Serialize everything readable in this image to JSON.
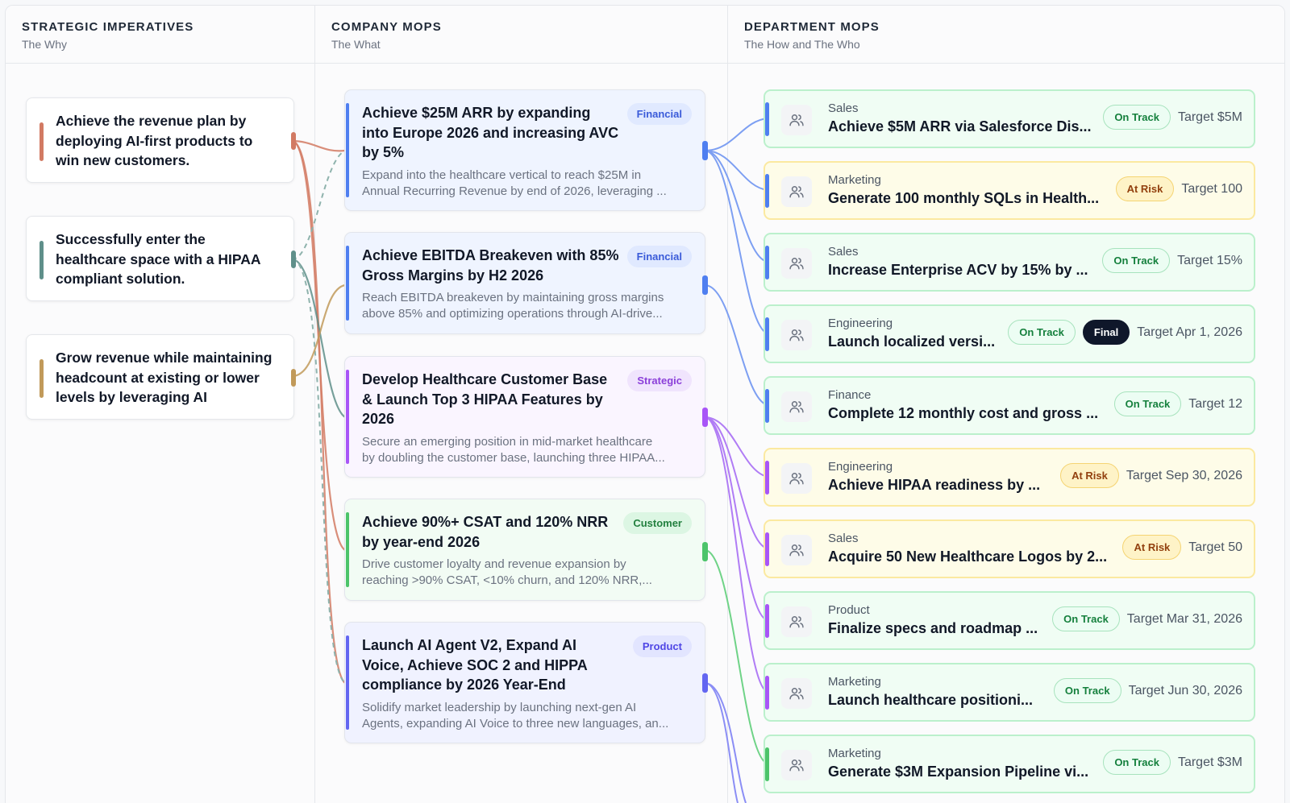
{
  "columns": [
    {
      "title": "STRATEGIC IMPERATIVES",
      "subtitle": "The Why"
    },
    {
      "title": "COMPANY MOPS",
      "subtitle": "The What"
    },
    {
      "title": "DEPARTMENT MOPS",
      "subtitle": "The How and The Who"
    }
  ],
  "imperatives": [
    {
      "text": "Achieve the revenue plan by deploying AI-first products to win new customers.",
      "color": "#d27a63"
    },
    {
      "text": "Successfully enter the healthcare space with a HIPAA compliant solution.",
      "color": "#5f8f8a"
    },
    {
      "text": "Grow revenue while maintaining headcount at existing or lower levels by leveraging AI",
      "color": "#c19a5a"
    }
  ],
  "company_mops": [
    {
      "title": "Achieve $25M ARR by expanding into Europe 2026 and increasing AVC by 5%",
      "tag": "Financial",
      "desc1": "Expand into the healthcare vertical to reach $25M in",
      "desc2": "Annual Recurring Revenue by end of 2026, leveraging ...",
      "color": "#4f7ff0",
      "bg": "#eff4ff",
      "tag_bg": "#e0e9ff",
      "tag_fg": "#3a5bd9"
    },
    {
      "title": "Achieve EBITDA Breakeven with 85% Gross Margins by H2 2026",
      "tag": "Financial",
      "desc1": "Reach EBITDA breakeven by maintaining gross margins",
      "desc2": "above 85% and optimizing operations through AI-drive...",
      "color": "#4f7ff0",
      "bg": "#eff4ff",
      "tag_bg": "#e0e9ff",
      "tag_fg": "#3a5bd9"
    },
    {
      "title": "Develop Healthcare Customer Base & Launch Top 3 HIPAA Features by 2026",
      "tag": "Strategic",
      "desc1": "Secure an emerging position in mid-market healthcare",
      "desc2": "by doubling the customer base, launching three HIPAA...",
      "color": "#a855f7",
      "bg": "#faf5ff",
      "tag_bg": "#f0e4fd",
      "tag_fg": "#8b3fd9"
    },
    {
      "title": "Achieve 90%+ CSAT and 120% NRR by year-end 2026",
      "tag": "Customer",
      "desc1": "Drive customer loyalty and revenue expansion by",
      "desc2": "reaching >90% CSAT, <10% churn, and 120% NRR,...",
      "color": "#4cc46a",
      "bg": "#f2fcf4",
      "tag_bg": "#dcf6e3",
      "tag_fg": "#23803f"
    },
    {
      "title": "Launch AI Agent V2, Expand AI Voice, Achieve SOC 2 and HIPPA compliance by 2026 Year-End",
      "tag": "Product",
      "desc1": "Solidify market leadership by launching next-gen AI",
      "desc2": "Agents, expanding AI Voice to three new languages, an...",
      "color": "#6366f1",
      "bg": "#f0f2ff",
      "tag_bg": "#e2e5ff",
      "tag_fg": "#4f46e5"
    }
  ],
  "dept_mops": [
    {
      "dept": "Sales",
      "title": "Achieve $5M ARR via Salesforce Dis...",
      "status": "On Track",
      "final": "",
      "target": "Target $5M",
      "tone": "green",
      "bar": "#4f7ff0"
    },
    {
      "dept": "Marketing",
      "title": "Generate 100 monthly SQLs in Health...",
      "status": "At Risk",
      "final": "",
      "target": "Target 100",
      "tone": "yellow",
      "bar": "#4f7ff0"
    },
    {
      "dept": "Sales",
      "title": "Increase Enterprise ACV by 15% by ...",
      "status": "On Track",
      "final": "",
      "target": "Target 15%",
      "tone": "green",
      "bar": "#4f7ff0"
    },
    {
      "dept": "Engineering",
      "title": "Launch localized versi...",
      "status": "On Track",
      "final": "Final",
      "target": "Target Apr 1, 2026",
      "tone": "green",
      "bar": "#4f7ff0"
    },
    {
      "dept": "Finance",
      "title": "Complete 12 monthly cost and gross ...",
      "status": "On Track",
      "final": "",
      "target": "Target 12",
      "tone": "green",
      "bar": "#4f7ff0"
    },
    {
      "dept": "Engineering",
      "title": "Achieve HIPAA readiness by ...",
      "status": "At Risk",
      "final": "",
      "target": "Target Sep 30, 2026",
      "tone": "yellow",
      "bar": "#a855f7"
    },
    {
      "dept": "Sales",
      "title": "Acquire 50 New Healthcare Logos by 2...",
      "status": "At Risk",
      "final": "",
      "target": "Target 50",
      "tone": "yellow",
      "bar": "#a855f7"
    },
    {
      "dept": "Product",
      "title": "Finalize specs and roadmap ...",
      "status": "On Track",
      "final": "",
      "target": "Target Mar 31, 2026",
      "tone": "green",
      "bar": "#a855f7"
    },
    {
      "dept": "Marketing",
      "title": "Launch healthcare positioni...",
      "status": "On Track",
      "final": "",
      "target": "Target Jun 30, 2026",
      "tone": "green",
      "bar": "#a855f7"
    },
    {
      "dept": "Marketing",
      "title": "Generate $3M Expansion Pipeline vi...",
      "status": "On Track",
      "final": "",
      "target": "Target $3M",
      "tone": "green",
      "bar": "#4cc46a"
    }
  ]
}
